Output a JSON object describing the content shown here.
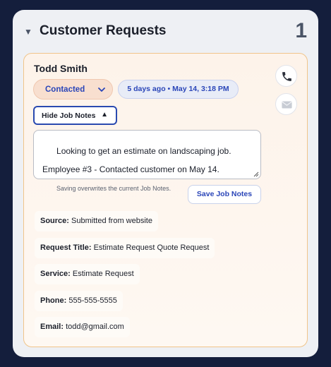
{
  "panel": {
    "title": "Customer Requests",
    "count": "1",
    "collapse_glyph": "▼",
    "collapse_icon": "triangle-down-icon"
  },
  "request": {
    "customer_name": "Todd Smith",
    "status": {
      "selected": "Contacted",
      "icon": "chevron-down-icon"
    },
    "timestamp": "5 days ago • May 14, 3:18 PM",
    "actions": {
      "call_icon": "phone-icon",
      "email_icon": "envelope-icon"
    },
    "notes_toggle": {
      "label": "Hide Job Notes",
      "glyph": "▲"
    },
    "notes_text": "Looking to get an estimate on landscaping job.\n\nEmployee #3 - Contacted customer on May 14.",
    "save_hint": "Saving overwrites the current Job Notes.",
    "save_label": "Save Job Notes",
    "fields": [
      {
        "label": "Source:",
        "value": "Submitted from website"
      },
      {
        "label": "Request Title:",
        "value": "Estimate Request Quote Request"
      },
      {
        "label": "Service:",
        "value": "Estimate Request"
      },
      {
        "label": "Phone:",
        "value": "555-555-5555"
      },
      {
        "label": "Email:",
        "value": "todd@gmail.com"
      }
    ]
  },
  "colors": {
    "page_background": "#141e3c",
    "accent_blue": "#2a45b8",
    "card_border": "#f0c48a"
  }
}
